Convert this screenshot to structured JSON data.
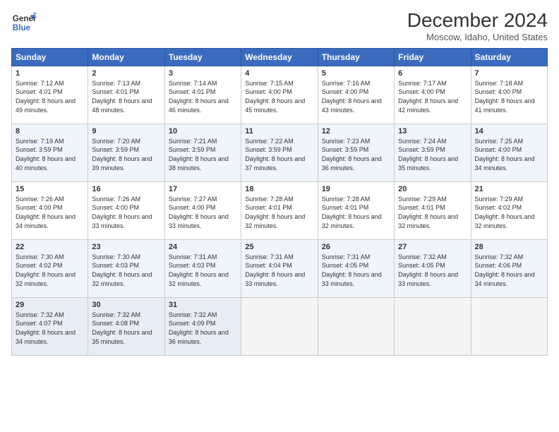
{
  "header": {
    "logo_line1": "General",
    "logo_line2": "Blue",
    "title": "December 2024",
    "subtitle": "Moscow, Idaho, United States"
  },
  "days_of_week": [
    "Sunday",
    "Monday",
    "Tuesday",
    "Wednesday",
    "Thursday",
    "Friday",
    "Saturday"
  ],
  "weeks": [
    [
      {
        "day": "1",
        "sunrise": "7:12 AM",
        "sunset": "4:01 PM",
        "daylight": "8 hours and 49 minutes."
      },
      {
        "day": "2",
        "sunrise": "7:13 AM",
        "sunset": "4:01 PM",
        "daylight": "8 hours and 48 minutes."
      },
      {
        "day": "3",
        "sunrise": "7:14 AM",
        "sunset": "4:01 PM",
        "daylight": "8 hours and 46 minutes."
      },
      {
        "day": "4",
        "sunrise": "7:15 AM",
        "sunset": "4:00 PM",
        "daylight": "8 hours and 45 minutes."
      },
      {
        "day": "5",
        "sunrise": "7:16 AM",
        "sunset": "4:00 PM",
        "daylight": "8 hours and 43 minutes."
      },
      {
        "day": "6",
        "sunrise": "7:17 AM",
        "sunset": "4:00 PM",
        "daylight": "8 hours and 42 minutes."
      },
      {
        "day": "7",
        "sunrise": "7:18 AM",
        "sunset": "4:00 PM",
        "daylight": "8 hours and 41 minutes."
      }
    ],
    [
      {
        "day": "8",
        "sunrise": "7:19 AM",
        "sunset": "3:59 PM",
        "daylight": "8 hours and 40 minutes."
      },
      {
        "day": "9",
        "sunrise": "7:20 AM",
        "sunset": "3:59 PM",
        "daylight": "8 hours and 39 minutes."
      },
      {
        "day": "10",
        "sunrise": "7:21 AM",
        "sunset": "3:59 PM",
        "daylight": "8 hours and 38 minutes."
      },
      {
        "day": "11",
        "sunrise": "7:22 AM",
        "sunset": "3:59 PM",
        "daylight": "8 hours and 37 minutes."
      },
      {
        "day": "12",
        "sunrise": "7:23 AM",
        "sunset": "3:59 PM",
        "daylight": "8 hours and 36 minutes."
      },
      {
        "day": "13",
        "sunrise": "7:24 AM",
        "sunset": "3:59 PM",
        "daylight": "8 hours and 35 minutes."
      },
      {
        "day": "14",
        "sunrise": "7:25 AM",
        "sunset": "4:00 PM",
        "daylight": "8 hours and 34 minutes."
      }
    ],
    [
      {
        "day": "15",
        "sunrise": "7:26 AM",
        "sunset": "4:00 PM",
        "daylight": "8 hours and 34 minutes."
      },
      {
        "day": "16",
        "sunrise": "7:26 AM",
        "sunset": "4:00 PM",
        "daylight": "8 hours and 33 minutes."
      },
      {
        "day": "17",
        "sunrise": "7:27 AM",
        "sunset": "4:00 PM",
        "daylight": "8 hours and 33 minutes."
      },
      {
        "day": "18",
        "sunrise": "7:28 AM",
        "sunset": "4:01 PM",
        "daylight": "8 hours and 32 minutes."
      },
      {
        "day": "19",
        "sunrise": "7:28 AM",
        "sunset": "4:01 PM",
        "daylight": "8 hours and 32 minutes."
      },
      {
        "day": "20",
        "sunrise": "7:29 AM",
        "sunset": "4:01 PM",
        "daylight": "8 hours and 32 minutes."
      },
      {
        "day": "21",
        "sunrise": "7:29 AM",
        "sunset": "4:02 PM",
        "daylight": "8 hours and 32 minutes."
      }
    ],
    [
      {
        "day": "22",
        "sunrise": "7:30 AM",
        "sunset": "4:02 PM",
        "daylight": "8 hours and 32 minutes."
      },
      {
        "day": "23",
        "sunrise": "7:30 AM",
        "sunset": "4:03 PM",
        "daylight": "8 hours and 32 minutes."
      },
      {
        "day": "24",
        "sunrise": "7:31 AM",
        "sunset": "4:03 PM",
        "daylight": "8 hours and 32 minutes."
      },
      {
        "day": "25",
        "sunrise": "7:31 AM",
        "sunset": "4:04 PM",
        "daylight": "8 hours and 33 minutes."
      },
      {
        "day": "26",
        "sunrise": "7:31 AM",
        "sunset": "4:05 PM",
        "daylight": "8 hours and 33 minutes."
      },
      {
        "day": "27",
        "sunrise": "7:32 AM",
        "sunset": "4:05 PM",
        "daylight": "8 hours and 33 minutes."
      },
      {
        "day": "28",
        "sunrise": "7:32 AM",
        "sunset": "4:06 PM",
        "daylight": "8 hours and 34 minutes."
      }
    ],
    [
      {
        "day": "29",
        "sunrise": "7:32 AM",
        "sunset": "4:07 PM",
        "daylight": "8 hours and 34 minutes."
      },
      {
        "day": "30",
        "sunrise": "7:32 AM",
        "sunset": "4:08 PM",
        "daylight": "8 hours and 35 minutes."
      },
      {
        "day": "31",
        "sunrise": "7:32 AM",
        "sunset": "4:09 PM",
        "daylight": "8 hours and 36 minutes."
      },
      null,
      null,
      null,
      null
    ]
  ]
}
